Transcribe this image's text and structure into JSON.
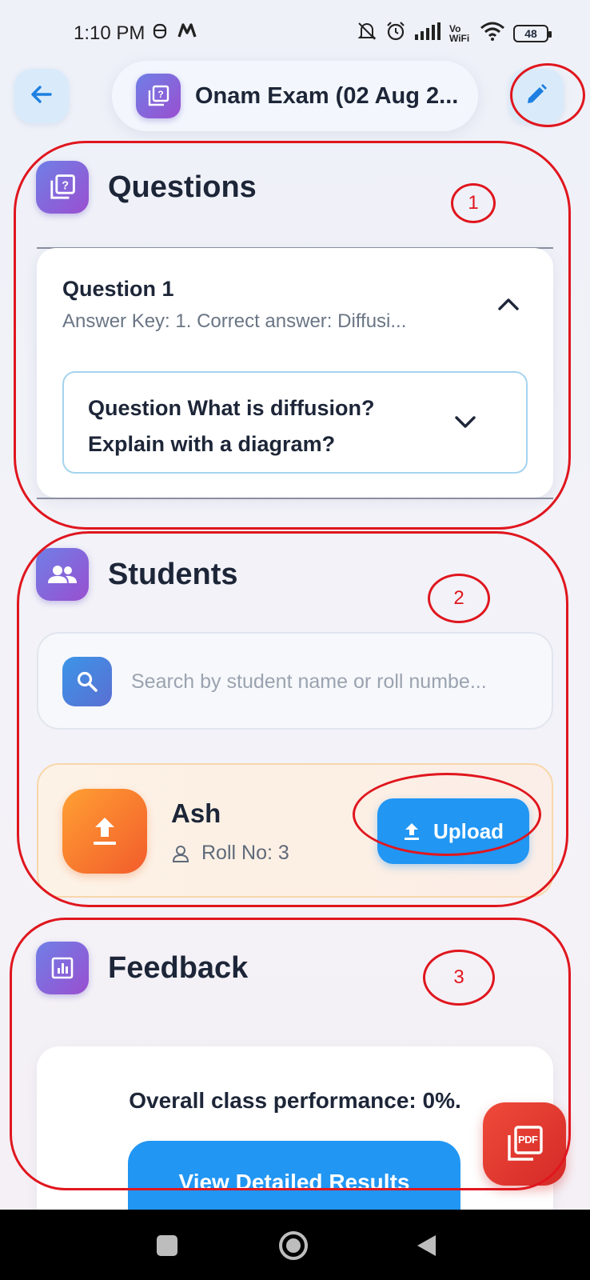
{
  "status_bar": {
    "time": "1:10 PM",
    "icons": [
      "debug-icon",
      "m-app-icon",
      "mute-icon",
      "alarm-icon",
      "signal-icon",
      "vowifi-icon",
      "wifi-icon"
    ],
    "vowifi": "Vo WiFi",
    "battery": "48"
  },
  "header": {
    "title": "Onam Exam (02 Aug 2...",
    "back_icon": "arrow-left-icon",
    "edit_icon": "pencil-icon"
  },
  "questions": {
    "heading": "Questions",
    "items": [
      {
        "title": "Question 1",
        "answer_key": "Answer Key: 1. Correct answer: Diffusi...",
        "question_text": "Question What is diffusion? Explain with a diagram?"
      }
    ]
  },
  "students": {
    "heading": "Students",
    "search_placeholder": "Search by student name or roll numbe...",
    "list": [
      {
        "name": "Ash",
        "roll": "Roll No: 3",
        "action": "Upload"
      }
    ]
  },
  "feedback": {
    "heading": "Feedback",
    "performance": "Overall class performance: 0%.",
    "button": "View Detailed Results",
    "fab_label": "PDF"
  },
  "annotations": [
    "1",
    "2",
    "3"
  ],
  "colors": {
    "primary": "#2196f3",
    "accent_gradient_start": "#6f7fe6",
    "accent_gradient_end": "#9a4fd0",
    "annotation_red": "#e0161e",
    "upload_orange": "#f25c2b",
    "pdf_red": "#d42a27"
  }
}
